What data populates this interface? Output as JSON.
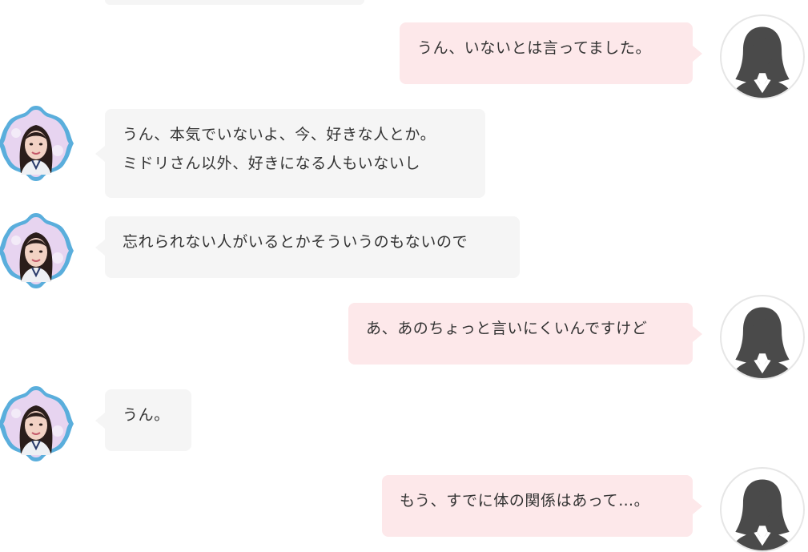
{
  "chat": {
    "messages": [
      {
        "side": "right",
        "avatar": "user-silhouette-icon",
        "lines": [
          "うん、いないとは言ってました。"
        ]
      },
      {
        "side": "left",
        "avatar": "agent-portrait",
        "lines": [
          "うん、本気でいないよ、今、好きな人とか。",
          "ミドリさん以外、好きになる人もいないし"
        ]
      },
      {
        "side": "left",
        "avatar": "agent-portrait",
        "lines": [
          "忘れられない人がいるとかそういうのもないので"
        ]
      },
      {
        "side": "right",
        "avatar": "user-silhouette-icon",
        "lines": [
          "あ、あのちょっと言いにくいんですけど"
        ]
      },
      {
        "side": "left",
        "avatar": "agent-portrait",
        "lines": [
          "うん。"
        ]
      },
      {
        "side": "right",
        "avatar": "user-silhouette-icon",
        "lines": [
          "もう、すでに体の関係はあって…。"
        ]
      }
    ]
  },
  "colors": {
    "left_bubble": "#f5f5f5",
    "right_bubble": "#fde8ea",
    "text": "#333333",
    "agent_frame": "#5aaedc"
  }
}
